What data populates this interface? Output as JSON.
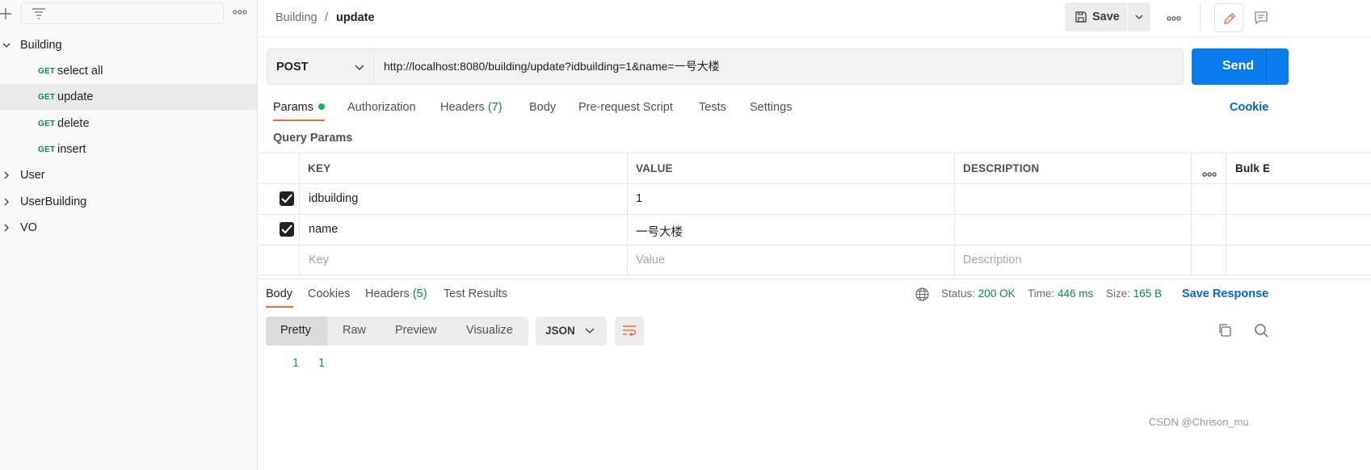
{
  "sidebar": {
    "add_icon": "plus-icon",
    "filter_icon": "filter-icon",
    "more_icon": "more-horizontal-icon",
    "tree": [
      {
        "label": "Building",
        "expanded": true
      },
      {
        "method": "GET",
        "name": "select all"
      },
      {
        "method": "GET",
        "name": "update",
        "selected": true
      },
      {
        "method": "GET",
        "name": "delete"
      },
      {
        "method": "GET",
        "name": "insert"
      },
      {
        "label": "User",
        "expanded": false
      },
      {
        "label": "UserBuilding",
        "expanded": false
      },
      {
        "label": "VO",
        "expanded": false
      }
    ]
  },
  "header": {
    "breadcrumb_parent": "Building",
    "breadcrumb_sep": "/",
    "breadcrumb_current": "update",
    "save_label": "Save"
  },
  "request": {
    "method": "POST",
    "url": "http://localhost:8080/building/update?idbuilding=1&name=一号大楼",
    "send_label": "Send",
    "tabs": [
      {
        "label": "Params"
      },
      {
        "label": "Authorization"
      },
      {
        "label": "Headers",
        "count": "(7)"
      },
      {
        "label": "Body"
      },
      {
        "label": "Pre-request Script"
      },
      {
        "label": "Tests"
      },
      {
        "label": "Settings"
      }
    ],
    "cookies_label": "Cookie"
  },
  "query_params": {
    "title": "Query Params",
    "headers": {
      "key": "KEY",
      "value": "VALUE",
      "description": "DESCRIPTION",
      "bulk": "Bulk E"
    },
    "rows": [
      {
        "key": "idbuilding",
        "value": "1",
        "checked": true
      },
      {
        "key": "name",
        "value": "一号大楼",
        "checked": true
      }
    ],
    "placeholders": {
      "key": "Key",
      "value": "Value",
      "description": "Description"
    }
  },
  "response": {
    "tabs": [
      {
        "label": "Body"
      },
      {
        "label": "Cookies"
      },
      {
        "label": "Headers",
        "count": "(5)"
      },
      {
        "label": "Test Results"
      }
    ],
    "status_label": "Status:",
    "status_value": "200 OK",
    "time_label": "Time:",
    "time_value": "446 ms",
    "size_label": "Size:",
    "size_value": "165 B",
    "save_response": "Save Response",
    "views": [
      "Pretty",
      "Raw",
      "Preview",
      "Visualize"
    ],
    "format": "JSON",
    "lines": [
      {
        "num": "1",
        "text": "1"
      }
    ]
  },
  "watermark": "CSDN @Chrison_mu",
  "colors": {
    "accent_orange": "#f26b3a",
    "send_blue": "#097bed",
    "status_green": "#0b8a4a",
    "link_blue": "#0265d2"
  }
}
